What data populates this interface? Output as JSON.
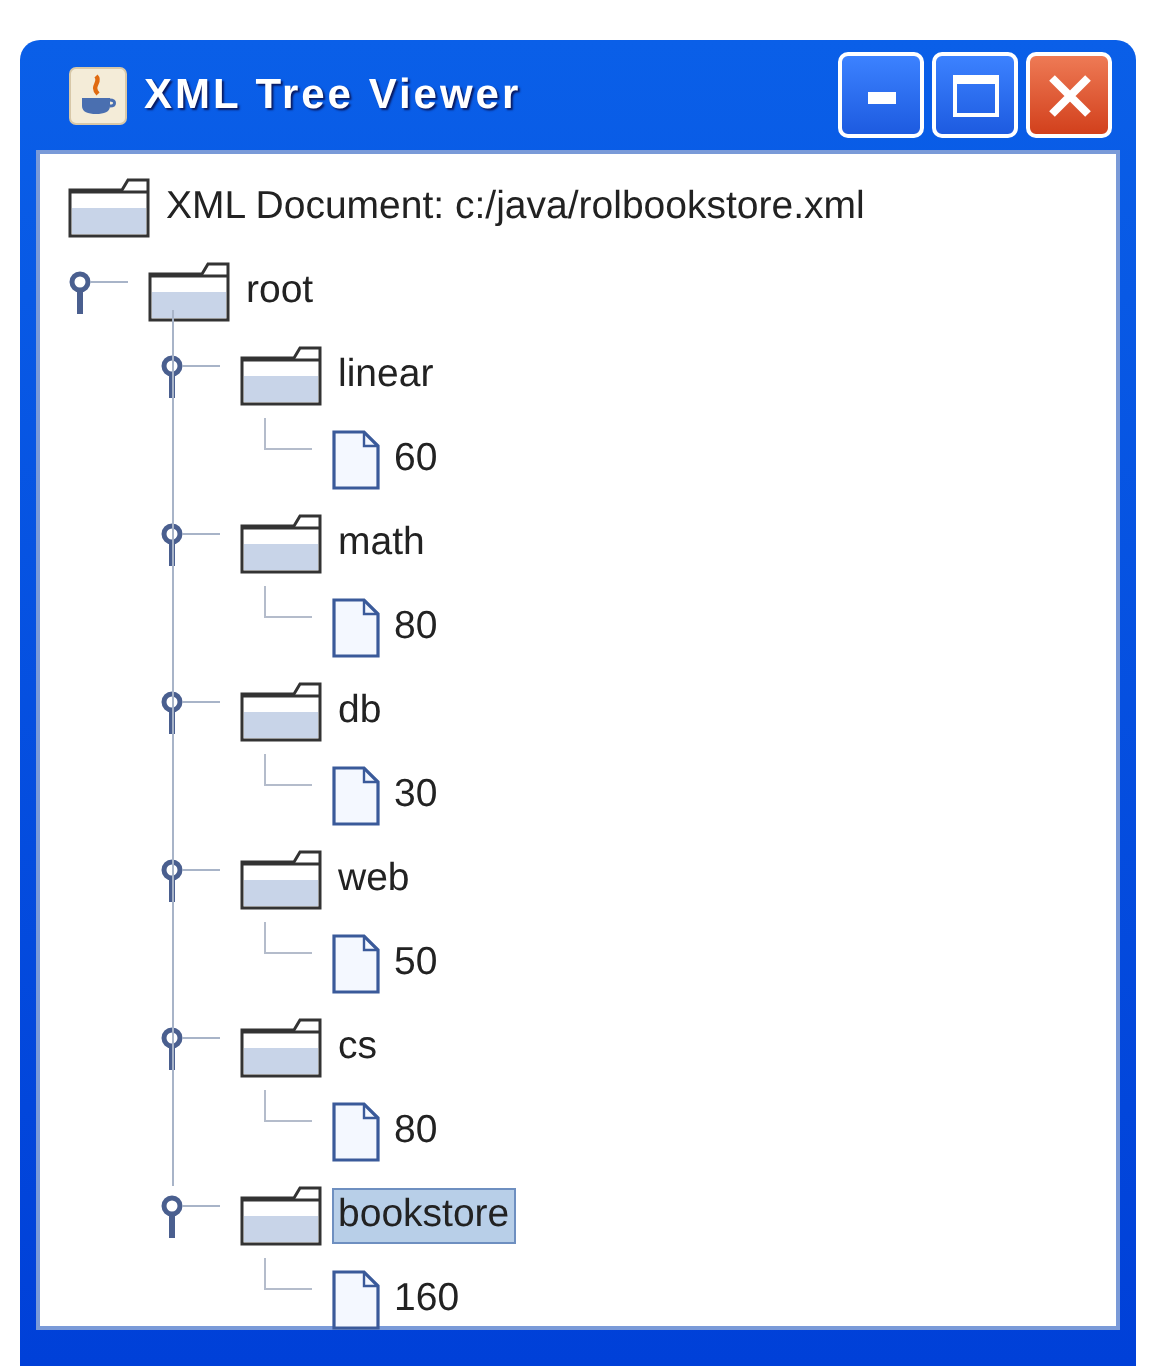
{
  "window": {
    "title": "XML Tree Viewer"
  },
  "tree": {
    "label": "XML Document: c:/java/rolbookstore.xml",
    "kind": "folder",
    "children": [
      {
        "label": "root",
        "kind": "folder",
        "expanded": true,
        "selected": false,
        "children": [
          {
            "label": "linear",
            "kind": "folder",
            "expanded": true,
            "selected": false,
            "children": [
              {
                "label": "60",
                "kind": "leaf",
                "selected": false
              }
            ]
          },
          {
            "label": "math",
            "kind": "folder",
            "expanded": true,
            "selected": false,
            "children": [
              {
                "label": "80",
                "kind": "leaf",
                "selected": false
              }
            ]
          },
          {
            "label": "db",
            "kind": "folder",
            "expanded": true,
            "selected": false,
            "children": [
              {
                "label": "30",
                "kind": "leaf",
                "selected": false
              }
            ]
          },
          {
            "label": "web",
            "kind": "folder",
            "expanded": true,
            "selected": false,
            "children": [
              {
                "label": "50",
                "kind": "leaf",
                "selected": false
              }
            ]
          },
          {
            "label": "cs",
            "kind": "folder",
            "expanded": true,
            "selected": false,
            "children": [
              {
                "label": "80",
                "kind": "leaf",
                "selected": false
              }
            ]
          },
          {
            "label": "bookstore",
            "kind": "folder",
            "expanded": true,
            "selected": true,
            "children": [
              {
                "label": "160",
                "kind": "leaf",
                "selected": false
              }
            ]
          }
        ]
      }
    ]
  }
}
